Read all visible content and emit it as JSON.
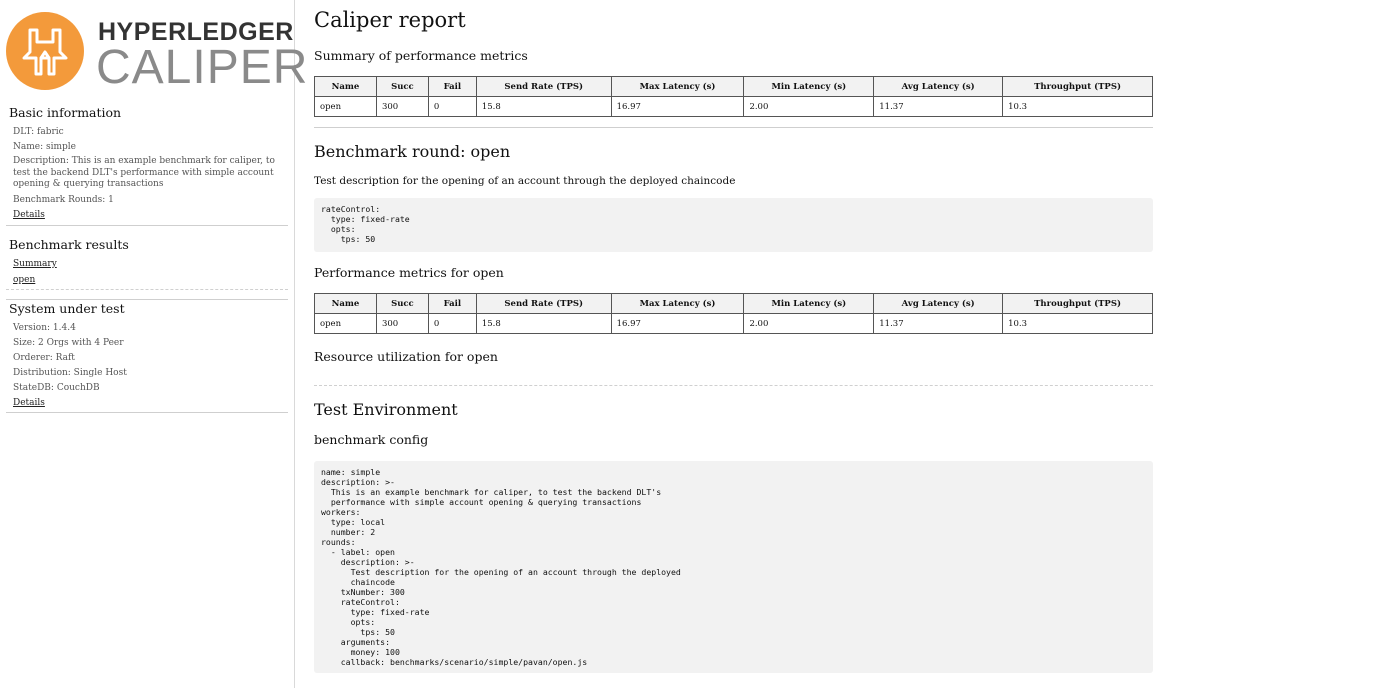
{
  "logo": {
    "line1": "HYPERLEDGER",
    "line2": "CALIPER",
    "color": "#f39a3b"
  },
  "sidebar": {
    "basic": {
      "title": "Basic information",
      "dlt": "DLT:  fabric",
      "name": "Name:  simple",
      "description": "Description:  This is an example benchmark for caliper, to test the backend DLT's performance with simple account opening & querying transactions",
      "rounds": "Benchmark Rounds:  1",
      "details": "Details"
    },
    "results": {
      "title": "Benchmark results",
      "summary": "Summary",
      "open": "open"
    },
    "sut": {
      "title": "System under test",
      "version": "Version:  1.4.4",
      "size": "Size:  2 Orgs with 4 Peer",
      "orderer": "Orderer:  Raft",
      "distribution": "Distribution:  Single Host",
      "statedb": "StateDB:  CouchDB",
      "details": "Details"
    }
  },
  "main": {
    "title": "Caliper report",
    "summary_title": "Summary of performance metrics",
    "columns": [
      "Name",
      "Succ",
      "Fail",
      "Send Rate (TPS)",
      "Max Latency (s)",
      "Min Latency (s)",
      "Avg Latency (s)",
      "Throughput (TPS)"
    ],
    "summary_row": [
      "open",
      "300",
      "0",
      "15.8",
      "16.97",
      "2.00",
      "11.37",
      "10.3"
    ],
    "round_title": "Benchmark round: open",
    "round_desc": "Test description for the opening of an account through the deployed chaincode",
    "rate_control": "rateControl:\n  type: fixed-rate\n  opts:\n    tps: 50",
    "perf_title": "Performance metrics for open",
    "perf_row": [
      "open",
      "300",
      "0",
      "15.8",
      "16.97",
      "2.00",
      "11.37",
      "10.3"
    ],
    "resource_title": "Resource utilization for open",
    "env_title": "Test Environment",
    "config_title": "benchmark config",
    "config": "name: simple\ndescription: >-\n  This is an example benchmark for caliper, to test the backend DLT's\n  performance with simple account opening & querying transactions\nworkers:\n  type: local\n  number: 2\nrounds:\n  - label: open\n    description: >-\n      Test description for the opening of an account through the deployed\n      chaincode\n    txNumber: 300\n    rateControl:\n      type: fixed-rate\n      opts:\n        tps: 50\n    arguments:\n      money: 100\n    callback: benchmarks/scenario/simple/pavan/open.js"
  }
}
